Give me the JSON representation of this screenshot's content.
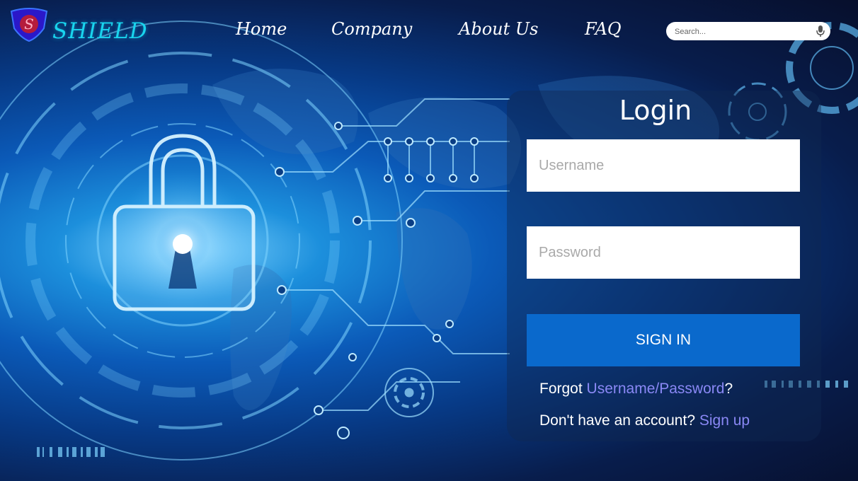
{
  "brand": {
    "initial": "S",
    "name": "SHIELD"
  },
  "nav": {
    "home": "Home",
    "company": "Company",
    "about": "About Us",
    "faq": "FAQ"
  },
  "search": {
    "placeholder": "Search...",
    "icon": "mic-icon"
  },
  "login": {
    "title": "Login",
    "username_placeholder": "Username",
    "password_placeholder": "Password",
    "signin_label": "SIGN IN",
    "forgot_prefix": "Forgot ",
    "forgot_link": "Username/Password",
    "forgot_suffix": "?",
    "signup_prefix": "Don't have an account? ",
    "signup_link": "Sign up"
  },
  "colors": {
    "brand_text": "#19d4ee",
    "accent_button": "#0a69cc",
    "link": "#8a88f5",
    "logo_shield": "#2b18c9"
  }
}
